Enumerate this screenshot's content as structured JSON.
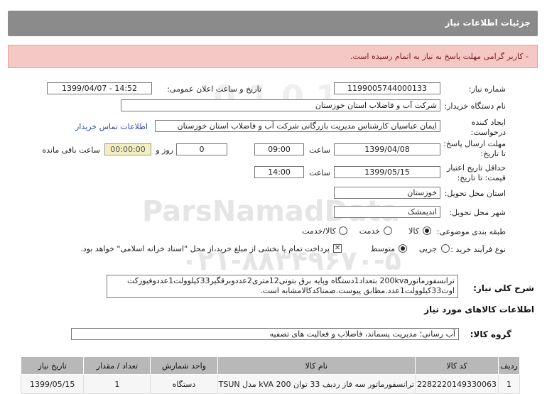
{
  "header": {
    "title": "جزئیات اطلاعات نیاز"
  },
  "alert": {
    "message": "- کاربر گرامی مهلت پاسخ به نیاز به اتمام رسیده است."
  },
  "form": {
    "need_number_label": "شماره نیاز:",
    "need_number": "1199005744000133",
    "announce_label": "تاریخ و ساعت اعلان عمومی:",
    "announce_value": "1399/04/07 - 14:52",
    "buyer_label": "نام دستگاه خریدار:",
    "buyer_value": "شرکت آب و فاضلاب استان خوزستان",
    "creator_label_1": "ایجاد کننده",
    "creator_label_2": "درخواست:",
    "creator_value": "ایمان عباسیان کارشناس مدیریت بازرگانی شرکت آب و فاضلاب استان خوزستان",
    "contact_link": "اطلاعات تماس خریدار",
    "deadline_label_1": "مهلت ارسال پاسخ:",
    "deadline_label_2": "تا تاریخ:",
    "deadline_date": "1399/04/08",
    "time_label": "ساعت",
    "deadline_time": "09:00",
    "days_value": "0",
    "days_label": "روز و",
    "remaining_time": "00:00:00",
    "remaining_label": "ساعت باقی مانده",
    "validity_label_1": "حداقل تاریخ اعتبار",
    "validity_label_2": "قیمت: تا تاریخ:",
    "validity_date": "1399/05/15",
    "validity_time_label": "ساعت",
    "validity_time": "14:00",
    "province_label": "استان محل تحویل:",
    "province_value": "خوزستان",
    "city_label": "شهر محل تحویل:",
    "city_value": "اندیمشک",
    "category_label": "طبقه بندی موضوعی:",
    "category_options": [
      "کالا",
      "خدمت",
      "کالا/خدمت"
    ],
    "category_selected": 0,
    "process_label": "نوع فرآیند خرید :",
    "process_options": [
      "جزیی",
      "متوسط"
    ],
    "process_selected": 1,
    "payment_text": "پرداخت تمام یا بخشی از مبلغ خرید،از محل \"اسناد خزانه اسلامی\" خواهد بود."
  },
  "description": {
    "label": "شرح کلی نیاز:",
    "text": "ترانسفورماتور200kva بتعداد1دستگاه وپایه برق بتونی12متری2عددوبرقگیر33کیلوولت1عددوفیوزکت اوت33کیلوولت1عدد.مطابق پیوست.ضمناکدکالامشابه است."
  },
  "goods_section": {
    "title": "اطلاعات کالاهای مورد نیاز",
    "group_label": "گروه کالا:",
    "group_value": "آب رسانی؛ مدیریت پسماند، فاضلاب و فعالیت های تصفیه"
  },
  "table": {
    "headers": [
      "ردیف",
      "کد کالا",
      "نام کالا",
      "واحد شمارش",
      "تعداد / مقدار",
      "تاریخ نیاز"
    ],
    "rows": [
      [
        "1",
        "2282220149330063",
        "ترانسفورماتور سه فاز ردیف 33 توان 200 kVA مدل TSUN",
        "دستگاه",
        "1",
        "1399/05/15"
      ]
    ]
  },
  "watermark": {
    "brand": "ParsNamadData",
    "phone": "۰۲۱-۸۸۳۴۹۶۷۰-۵"
  },
  "colors": {
    "header_bg": "#8c8b8b",
    "alert_bg": "#f5c7c5",
    "link": "#2a4aa8",
    "table_header_bg": "#b9b8b8"
  }
}
